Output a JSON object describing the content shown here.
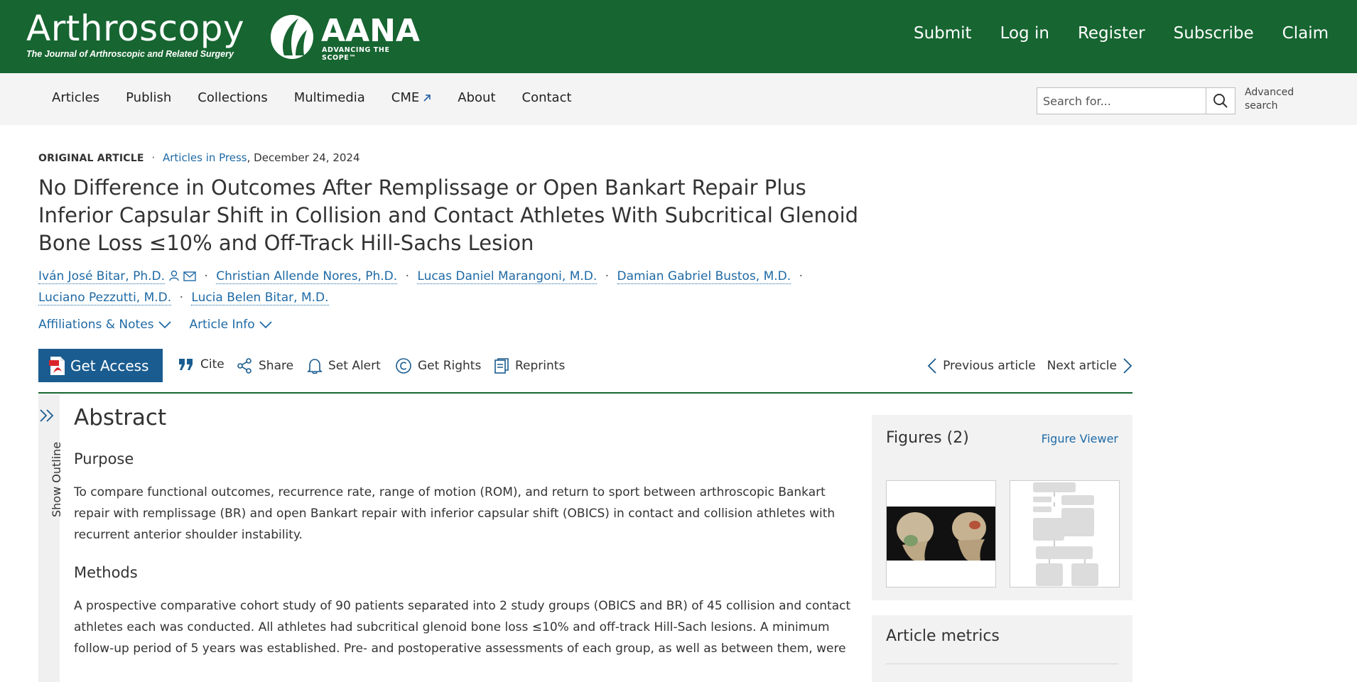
{
  "header": {
    "journal_title": "Arthroscopy",
    "journal_subtitle": "The Journal of Arthroscopic and Related Surgery",
    "partner_name": "AANA",
    "partner_tagline": "ADVANCING THE SCOPE™",
    "links": [
      "Submit",
      "Log in",
      "Register",
      "Subscribe",
      "Claim"
    ]
  },
  "nav": {
    "items": [
      "Articles",
      "Publish",
      "Collections",
      "Multimedia",
      "CME",
      "About",
      "Contact"
    ],
    "search_placeholder": "Search for...",
    "advanced_search": "Advanced search"
  },
  "article": {
    "type": "ORIGINAL ARTICLE",
    "section": "Articles in Press",
    "date": ", December 24, 2024",
    "title": "No Difference in Outcomes After Remplissage or Open Bankart Repair Plus Inferior Capsular Shift in Collision and Contact Athletes With Subcritical Glenoid Bone Loss ≤10% and Off-Track Hill-Sachs Lesion",
    "authors": [
      "Iván José Bitar, Ph.D.",
      "Christian Allende Nores, Ph.D.",
      "Lucas Daniel Marangoni, M.D.",
      "Damian Gabriel Bustos, M.D.",
      "Luciano Pezzutti, M.D.",
      "Lucia Belen Bitar, M.D."
    ],
    "affiliations_label": "Affiliations & Notes",
    "article_info_label": "Article Info"
  },
  "actions": {
    "get_access": "Get Access",
    "cite": "Cite",
    "share": "Share",
    "set_alert": "Set Alert",
    "get_rights": "Get Rights",
    "reprints": "Reprints",
    "previous": "Previous article",
    "next": "Next article"
  },
  "outline": {
    "label": "Show Outline"
  },
  "abstract": {
    "heading": "Abstract",
    "purpose_heading": "Purpose",
    "purpose_text": "To compare functional outcomes, recurrence rate, range of motion (ROM), and return to sport between arthroscopic Bankart repair with remplissage (BR) and open Bankart repair with inferior capsular shift (OBICS) in contact and collision athletes with recurrent anterior shoulder instability.",
    "methods_heading": "Methods",
    "methods_text": "A prospective comparative cohort study of 90 patients separated into 2 study groups (OBICS and BR) of 45 collision and contact athletes each was conducted. All athletes had subcritical glenoid bone loss ≤10% and off-track Hill-Sach lesions. A minimum follow-up period of 5 years was established. Pre- and postoperative assessments of each group, as well as between them, were"
  },
  "sidebar": {
    "figures_title": "Figures (2)",
    "figure_viewer": "Figure Viewer",
    "metrics_title": "Article metrics"
  },
  "colors": {
    "brand_green": "#176531",
    "link_blue": "#1f6aa5",
    "button_blue": "#1a5c8f"
  }
}
